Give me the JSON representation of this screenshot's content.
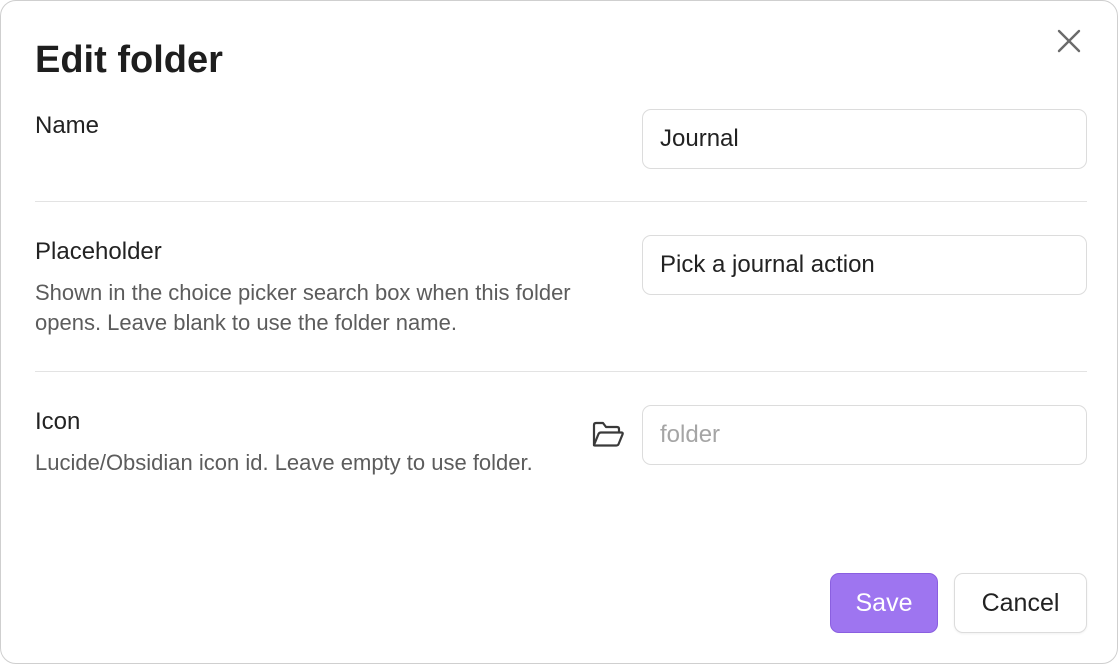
{
  "dialog": {
    "title": "Edit folder",
    "close_icon": "close-icon"
  },
  "settings": {
    "name": {
      "label": "Name",
      "value": "Journal"
    },
    "placeholder": {
      "label": "Placeholder",
      "description": "Shown in the choice picker search box when this folder opens. Leave blank to use the folder name.",
      "value": "Pick a journal action"
    },
    "icon": {
      "label": "Icon",
      "description": "Lucide/Obsidian icon id. Leave empty to use folder.",
      "value": "",
      "placeholder": "folder",
      "preview_icon": "folder-open-icon"
    }
  },
  "buttons": {
    "save_label": "Save",
    "cancel_label": "Cancel"
  },
  "colors": {
    "accent": "#9e75f0",
    "muted_text": "#5c5c5c",
    "border": "#dcdcdc"
  }
}
